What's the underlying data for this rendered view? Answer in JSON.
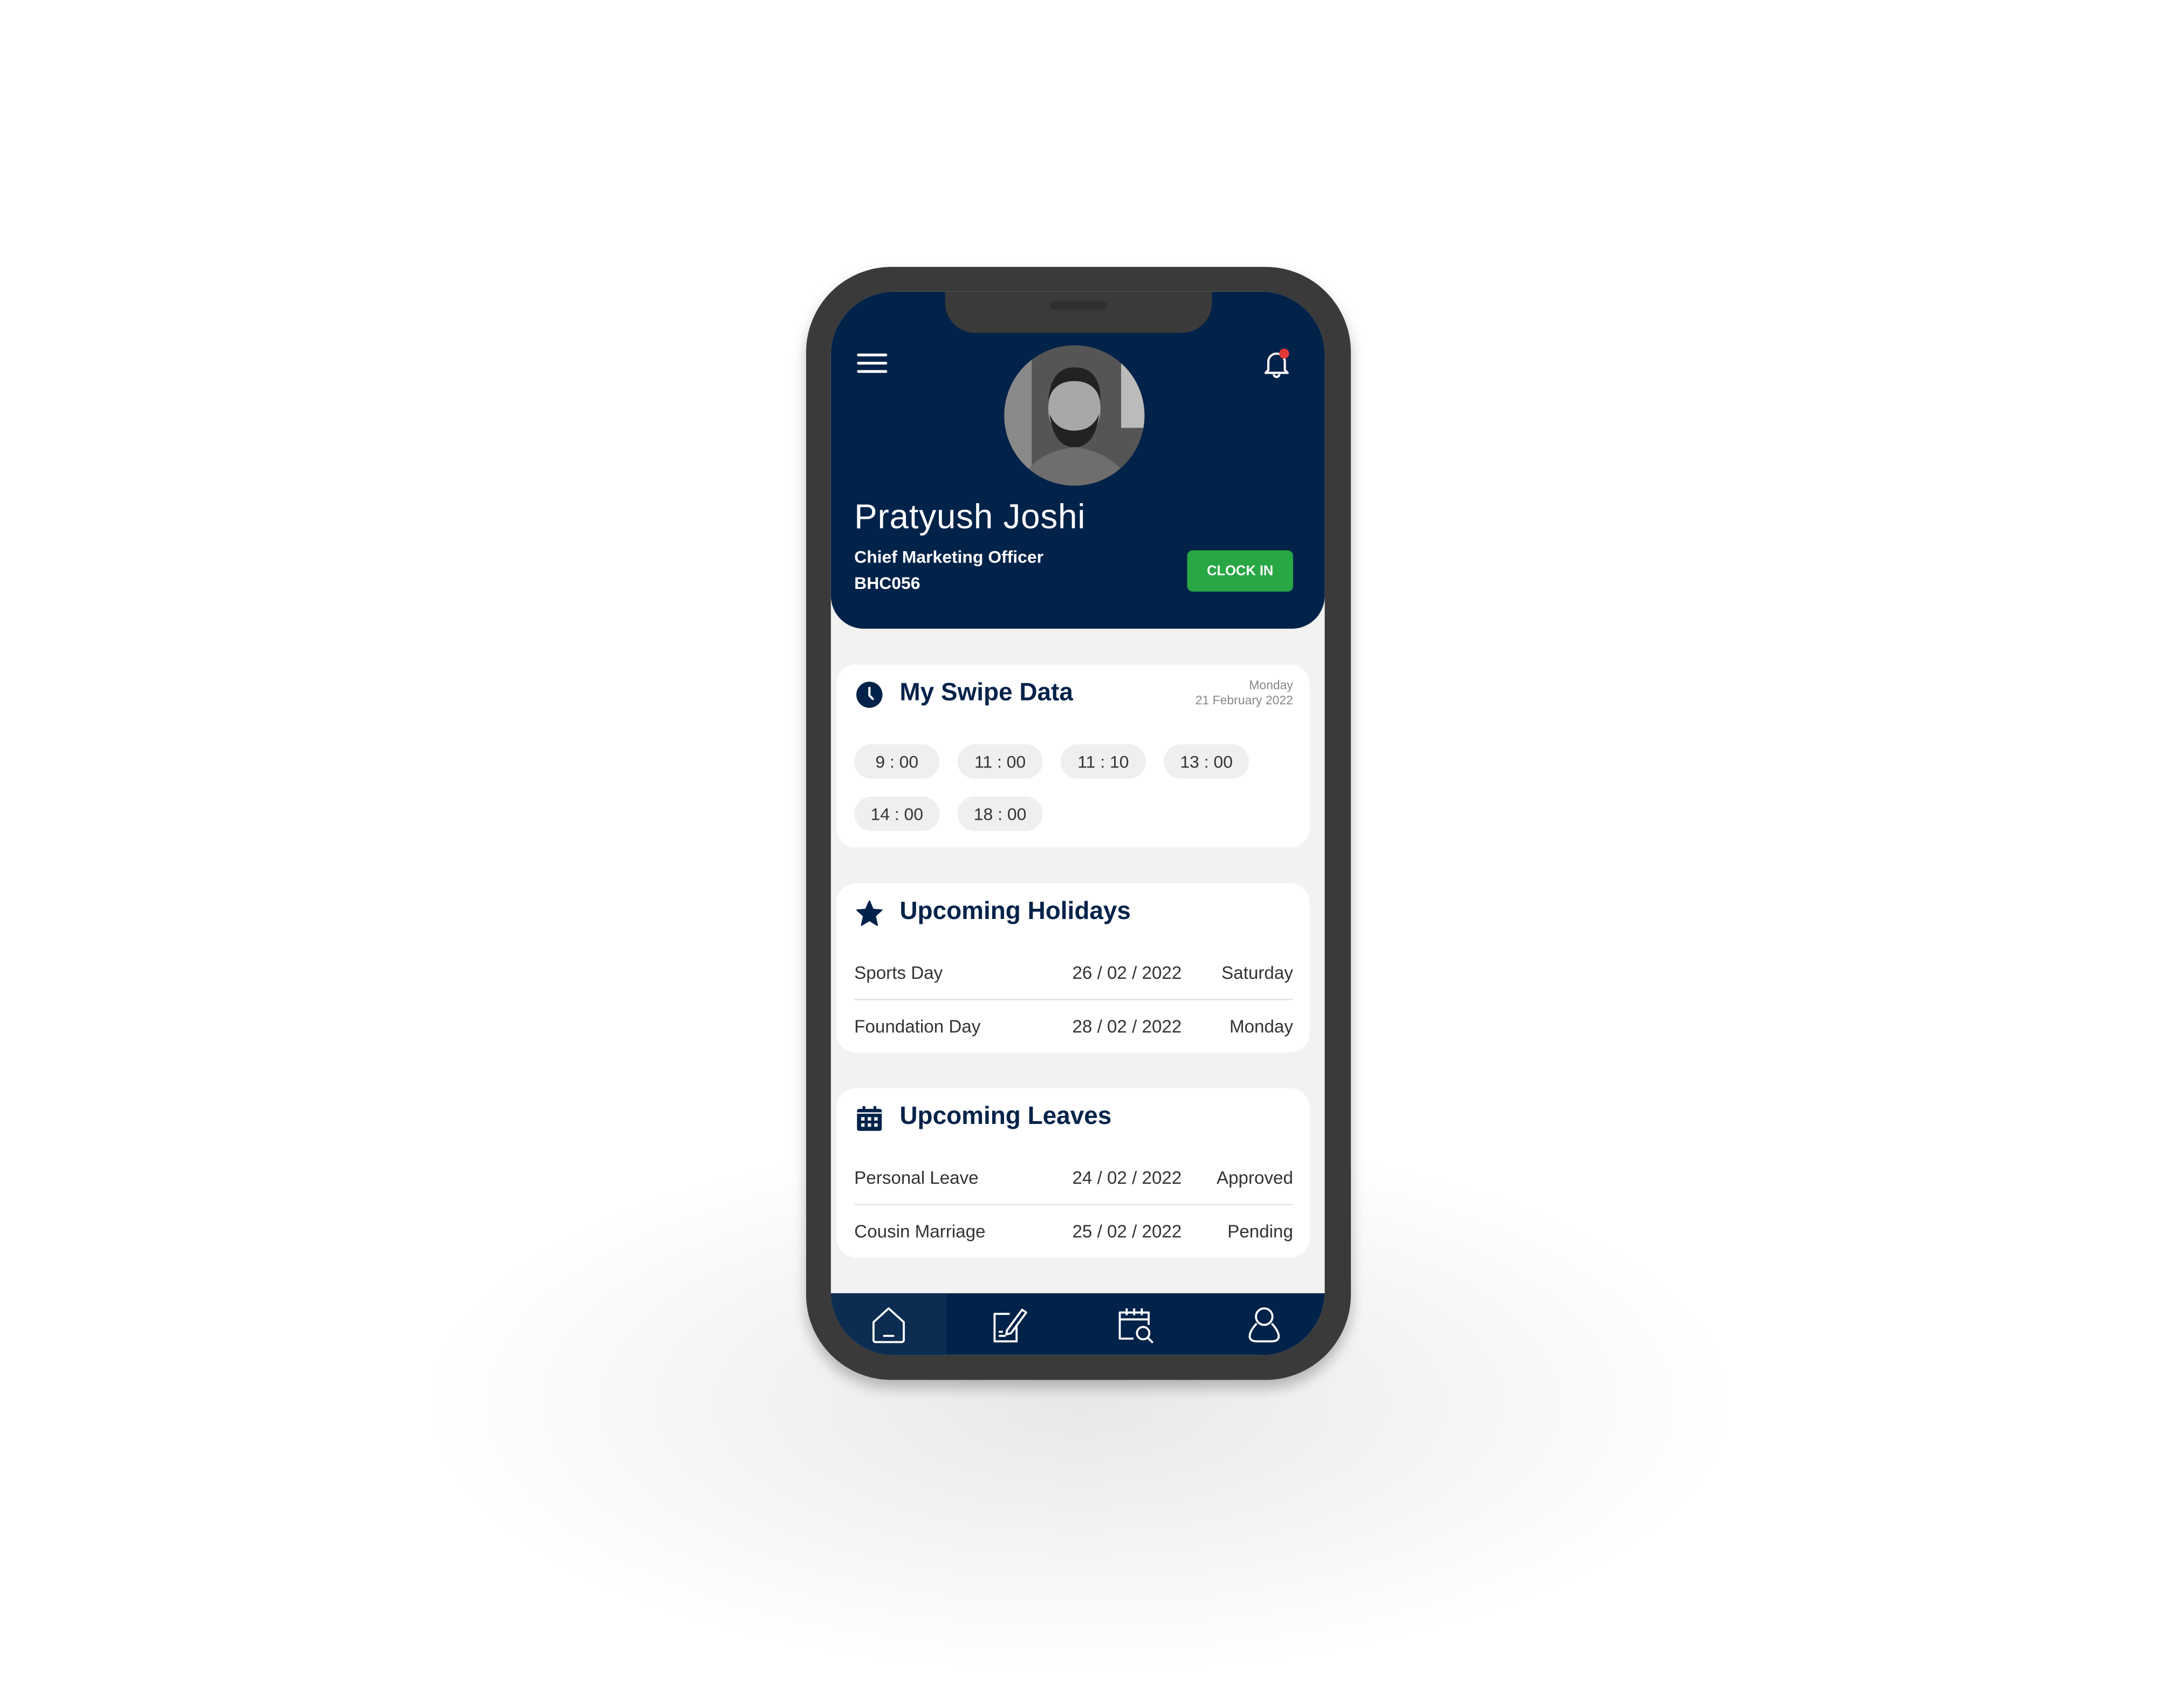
{
  "header": {
    "name": "Pratyush Joshi",
    "role": "Chief Marketing Officer",
    "employee_id": "BHC056",
    "clock_in_label": "CLOCK IN",
    "has_notification": true
  },
  "swipe": {
    "title": "My Swipe Data",
    "day": "Monday",
    "date": "21 February 2022",
    "times": [
      "9 : 00",
      "11 : 00",
      "11 : 10",
      "13 : 00",
      "14 : 00",
      "18 : 00"
    ]
  },
  "holidays": {
    "title": "Upcoming Holidays",
    "rows": [
      {
        "name": "Sports Day",
        "date": "26 / 02 / 2022",
        "day": "Saturday"
      },
      {
        "name": "Foundation Day",
        "date": "28 / 02 / 2022",
        "day": "Monday"
      }
    ]
  },
  "leaves": {
    "title": "Upcoming Leaves",
    "rows": [
      {
        "name": "Personal Leave",
        "date": "24 / 02 / 2022",
        "status": "Approved"
      },
      {
        "name": "Cousin Marriage",
        "date": "25 / 02 / 2022",
        "status": "Pending"
      }
    ]
  },
  "nav": {
    "items": [
      "home-icon",
      "edit-icon",
      "calendar-search-icon",
      "profile-icon"
    ],
    "active": 0
  },
  "colors": {
    "primary": "#012249",
    "accent": "#28a745",
    "notification": "#e53935"
  }
}
